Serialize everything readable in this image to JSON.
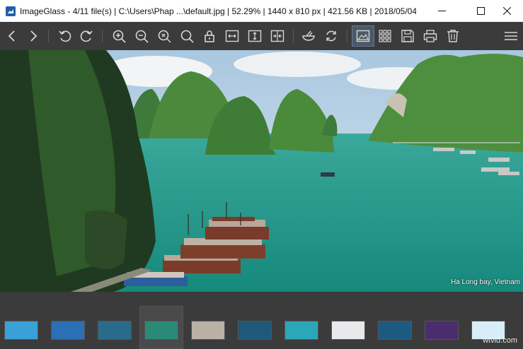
{
  "window": {
    "title": "ImageGlass - 4/11 file(s)  |  C:\\Users\\Phap ...\\default.jpg  |  52.29%  |  1440 x 810 px  |  421.56 KB  |  2018/05/04 0...",
    "minimize_icon": "minimize-icon",
    "maximize_icon": "maximize-icon",
    "close_icon": "close-icon"
  },
  "toolbar": {
    "buttons": [
      {
        "name": "back",
        "icon": "chevron-left-icon"
      },
      {
        "name": "forward",
        "icon": "chevron-right-icon"
      },
      {
        "name": "rotate-left",
        "icon": "rotate-left-icon"
      },
      {
        "name": "rotate-right",
        "icon": "rotate-right-icon"
      },
      {
        "name": "zoom-in",
        "icon": "zoom-in-icon"
      },
      {
        "name": "zoom-out",
        "icon": "zoom-out-icon"
      },
      {
        "name": "zoom-fit",
        "icon": "zoom-fit-icon"
      },
      {
        "name": "actual-size",
        "icon": "magnifier-icon"
      },
      {
        "name": "lock-zoom",
        "icon": "lock-icon"
      },
      {
        "name": "scale-width",
        "icon": "scale-width-icon"
      },
      {
        "name": "scale-height",
        "icon": "scale-height-icon"
      },
      {
        "name": "auto-zoom",
        "icon": "auto-zoom-icon"
      },
      {
        "name": "checkerboard",
        "icon": "bowl-icon"
      },
      {
        "name": "refresh",
        "icon": "refresh-icon"
      },
      {
        "name": "thumbnail-bar",
        "icon": "image-icon",
        "active": true
      },
      {
        "name": "grid",
        "icon": "grid-icon"
      },
      {
        "name": "save",
        "icon": "save-icon"
      },
      {
        "name": "print",
        "icon": "print-icon"
      },
      {
        "name": "delete",
        "icon": "trash-icon"
      },
      {
        "name": "menu",
        "icon": "hamburger-icon"
      }
    ]
  },
  "viewer": {
    "caption": "Ha Long bay, Vietnam"
  },
  "thumbnails": {
    "count": 11,
    "selected_index": 3
  },
  "watermark": "wtvid.com",
  "colors": {
    "toolbar_bg": "#3b3b3b",
    "icon": "#d6d6d6",
    "active_bg": "#4d5966",
    "water": "#1f9e8e"
  }
}
